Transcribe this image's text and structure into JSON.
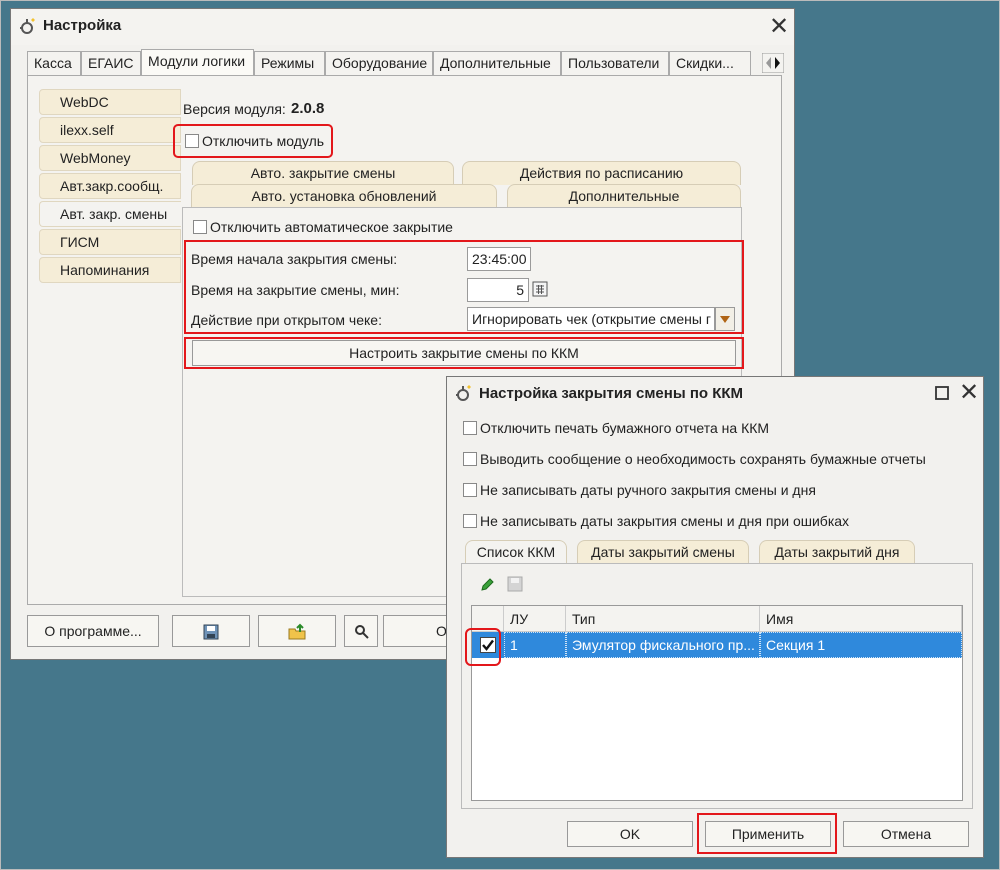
{
  "main_window": {
    "title": "Настройка",
    "tabs": [
      "Касса",
      "ЕГАИС",
      "Модули логики",
      "Режимы",
      "Оборудование",
      "Дополнительные",
      "Пользователи",
      "Скидки..."
    ],
    "active_tab": "Модули логики",
    "side_tabs": [
      "WebDC",
      "ilexx.self",
      "WebMoney",
      "Авт.закр.сообщ.",
      "Авт. закр. смены",
      "ГИСМ",
      "Напоминания"
    ],
    "active_side_tab": "Авт. закр. смены",
    "module_version_label": "Версия модуля:",
    "module_version": "2.0.8",
    "disable_module_label": "Отключить модуль",
    "sub_tabs_row1": [
      "Авто. закрытие смены",
      "Действия по расписанию"
    ],
    "sub_tabs_row2": [
      "Авто. установка обновлений",
      "Дополнительные"
    ],
    "disable_auto_close_label": "Отключить автоматическое закрытие",
    "start_time_label": "Время начала закрытия смены:",
    "start_time_value": "23:45:00",
    "duration_label": "Время на закрытие смены, мин:",
    "duration_value": "5",
    "open_check_label": "Действие при открытом чеке:",
    "open_check_value": "Игнорировать чек (открытие смены г",
    "configure_kkm_button": "Настроить закрытие смены по ККМ",
    "bottom_buttons": {
      "about": "О программе...",
      "partial": "О"
    }
  },
  "dialog": {
    "title": "Настройка закрытия смены по ККМ",
    "checkboxes": [
      "Отключить печать бумажного отчета на ККМ",
      "Выводить сообщение о необходимость сохранять бумажные отчеты",
      "Не записывать даты ручного закрытия смены и дня",
      "Не записывать даты закрытия смены и дня при ошибках"
    ],
    "tabs": [
      "Список ККМ",
      "Даты закрытий смены",
      "Даты закрытий дня"
    ],
    "active_tab": "Список ККМ",
    "columns": [
      "ЛУ",
      "Тип",
      "Имя"
    ],
    "rows": [
      {
        "checked": true,
        "lu": "1",
        "type": "Эмулятор фискального пр...",
        "name": "Секция 1"
      }
    ],
    "buttons": {
      "ok": "OK",
      "apply": "Применить",
      "cancel": "Отмена"
    }
  },
  "colors": {
    "highlight_red": "#e3171b",
    "row_selected": "#2f89dc",
    "tab_tan": "#f5edd7",
    "desktop": "#45778b"
  }
}
